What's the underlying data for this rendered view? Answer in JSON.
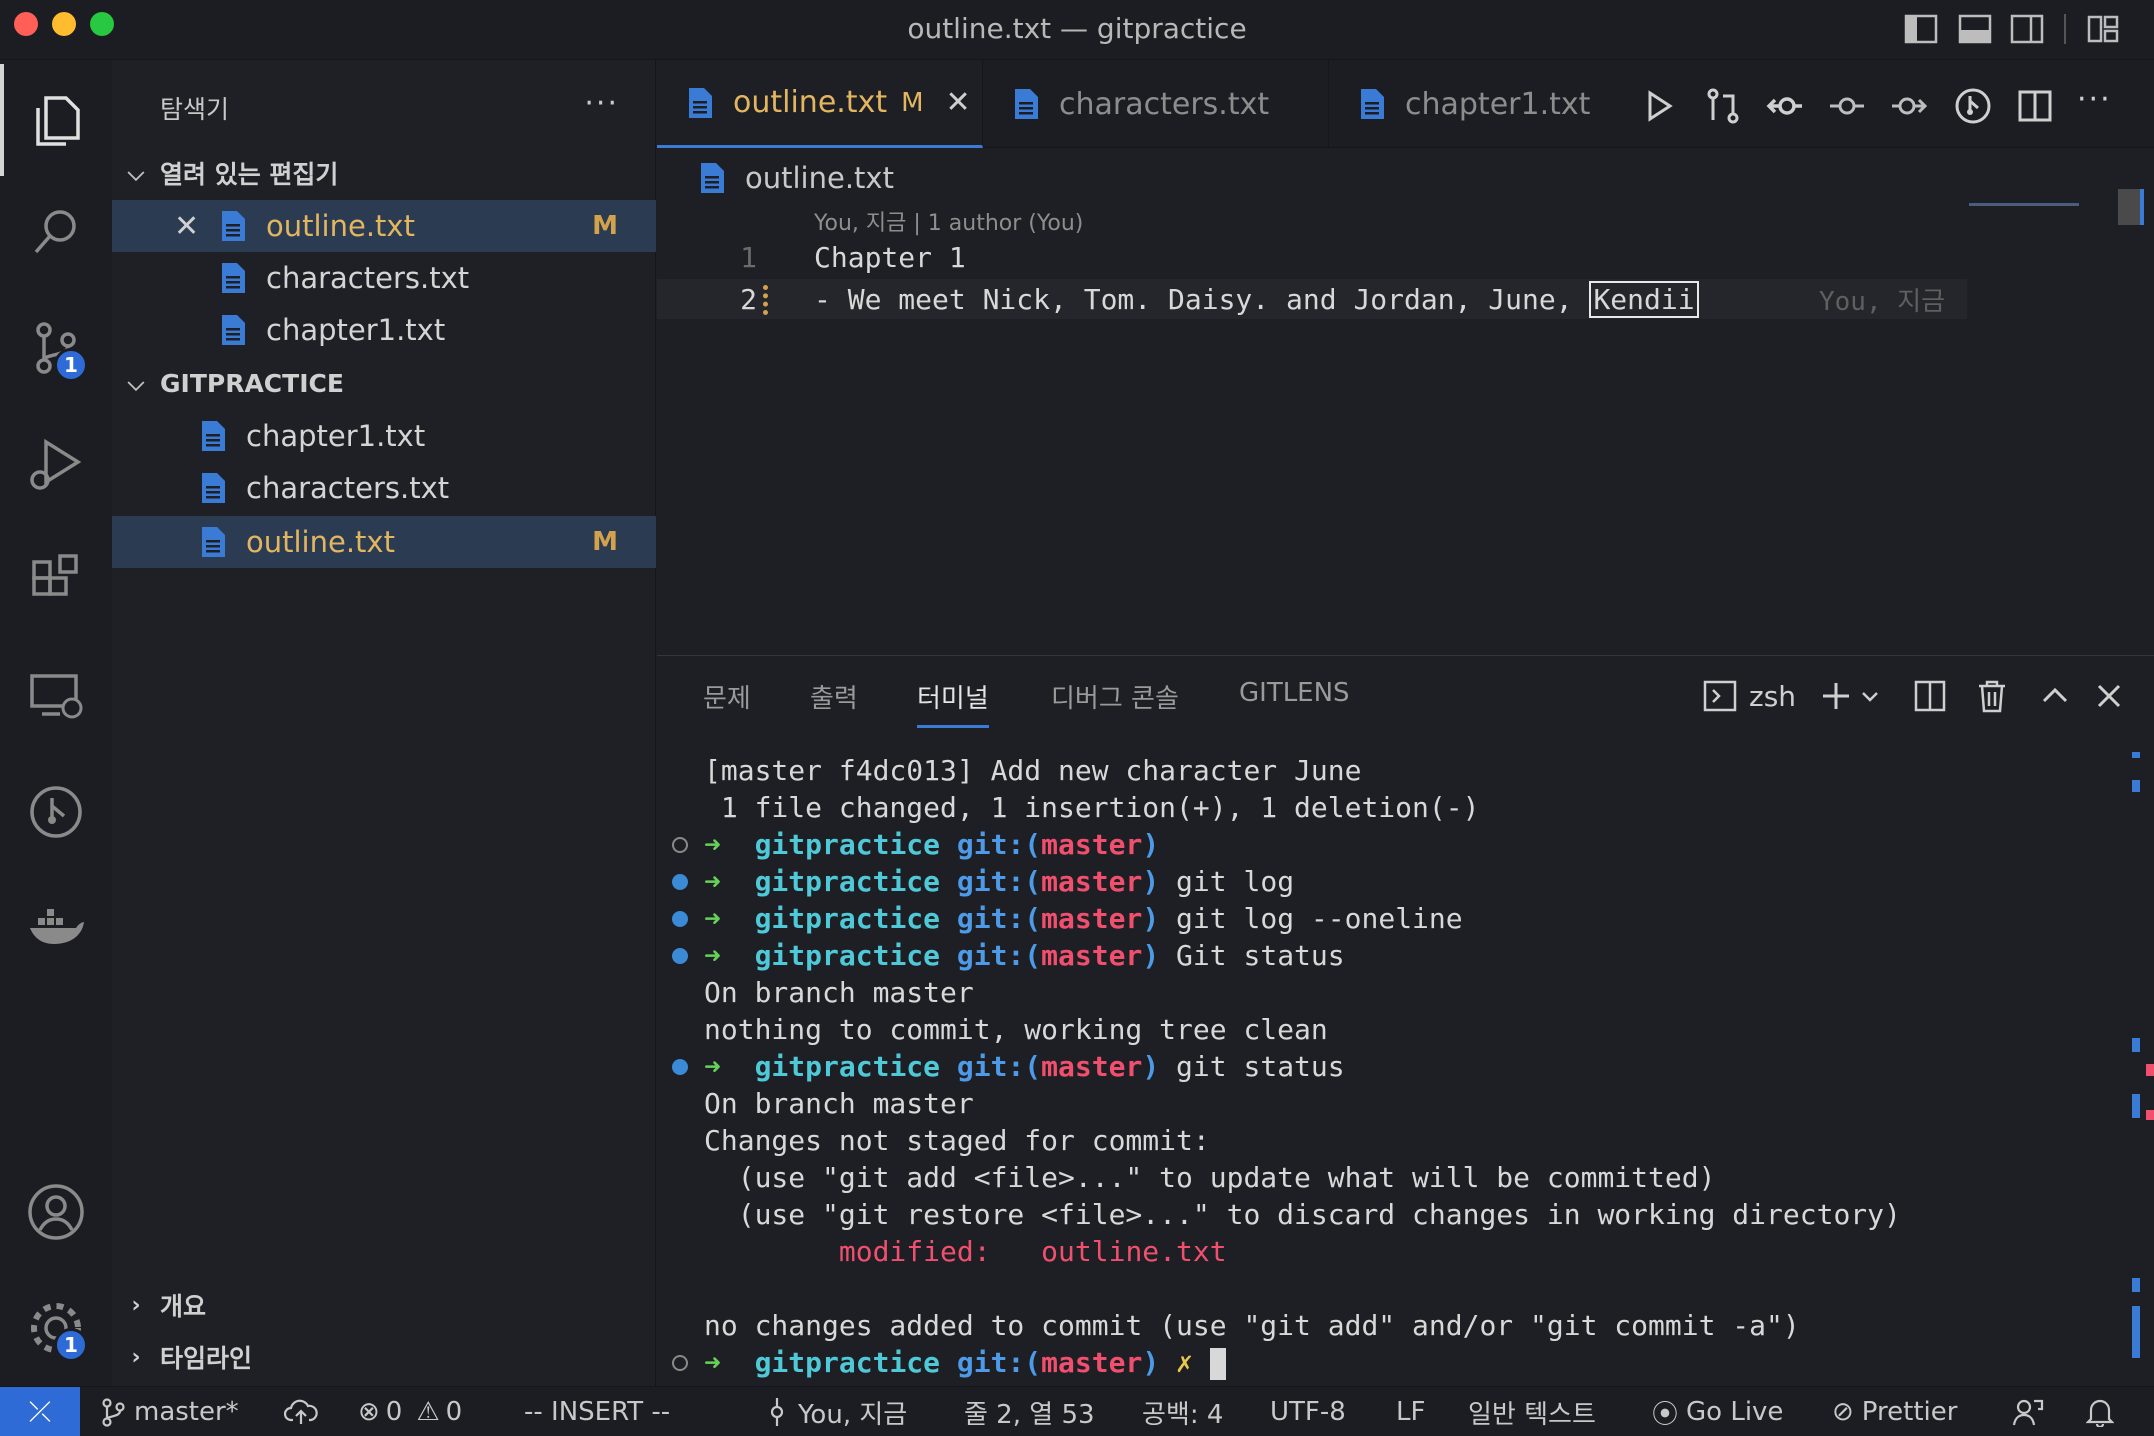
{
  "window": {
    "title": "outline.txt — gitpractice"
  },
  "sidebar": {
    "title": "탐색기",
    "more": "···",
    "open_editors": {
      "header": "열려 있는 편집기",
      "items": [
        {
          "name": "outline.txt",
          "mark": "M"
        },
        {
          "name": "characters.txt",
          "mark": ""
        },
        {
          "name": "chapter1.txt",
          "mark": ""
        }
      ]
    },
    "workspace": {
      "header": "GITPRACTICE",
      "items": [
        {
          "name": "chapter1.txt",
          "mark": ""
        },
        {
          "name": "characters.txt",
          "mark": ""
        },
        {
          "name": "outline.txt",
          "mark": "M"
        }
      ]
    },
    "outline_header": "개요",
    "timeline_header": "타임라인"
  },
  "activity": {
    "scm_badge": "1",
    "settings_badge": "1"
  },
  "tabs": [
    {
      "label": "outline.txt",
      "mark": "M"
    },
    {
      "label": "characters.txt"
    },
    {
      "label": "chapter1.txt"
    }
  ],
  "editor": {
    "breadcrumb": "outline.txt",
    "blame_header": "You, 지금 | 1 author (You)",
    "lines": [
      {
        "num": "1",
        "text": "Chapter 1"
      },
      {
        "num": "2",
        "text_before": "- We meet Nick, Tom. Daisy. and Jordan, June, ",
        "text_cursor": "Kendii"
      }
    ],
    "inline_blame": "You, 지금"
  },
  "panel": {
    "tabs": [
      "문제",
      "출력",
      "터미널",
      "디버그 콘솔",
      "GITLENS"
    ],
    "shell": "zsh",
    "terminal": {
      "l1": "[master f4dc013] Add new character June",
      "l2": " 1 file changed, 1 insertion(+), 1 deletion(-)",
      "arrow": "➜",
      "repo": "gitpractice",
      "git_prefix": "git:(",
      "branch": "master",
      "git_suffix": ")",
      "cmd_log": " git log",
      "cmd_oneline": " git log --oneline",
      "cmd_Status": " Git status",
      "l7": "On branch master",
      "l8": "nothing to commit, working tree clean",
      "cmd_status": " git status",
      "l10": "On branch master",
      "l11": "Changes not staged for commit:",
      "l12": "  (use \"git add <file>...\" to update what will be committed)",
      "l13": "  (use \"git restore <file>...\" to discard changes in working directory)",
      "l14_label": "        modified:   ",
      "l14_file": "outline.txt",
      "l16": "no changes added to commit (use \"git add\" and/or \"git commit -a\")",
      "xmark": " ✗ "
    }
  },
  "statusbar": {
    "branch": "master*",
    "errors": "0",
    "warnings": "0",
    "mode": "-- INSERT --",
    "blame": "You, 지금",
    "position": "줄 2, 열 53",
    "spaces": "공백: 4",
    "encoding": "UTF-8",
    "eol": "LF",
    "language": "일반 텍스트",
    "golive": "Go Live",
    "prettier": "Prettier"
  }
}
